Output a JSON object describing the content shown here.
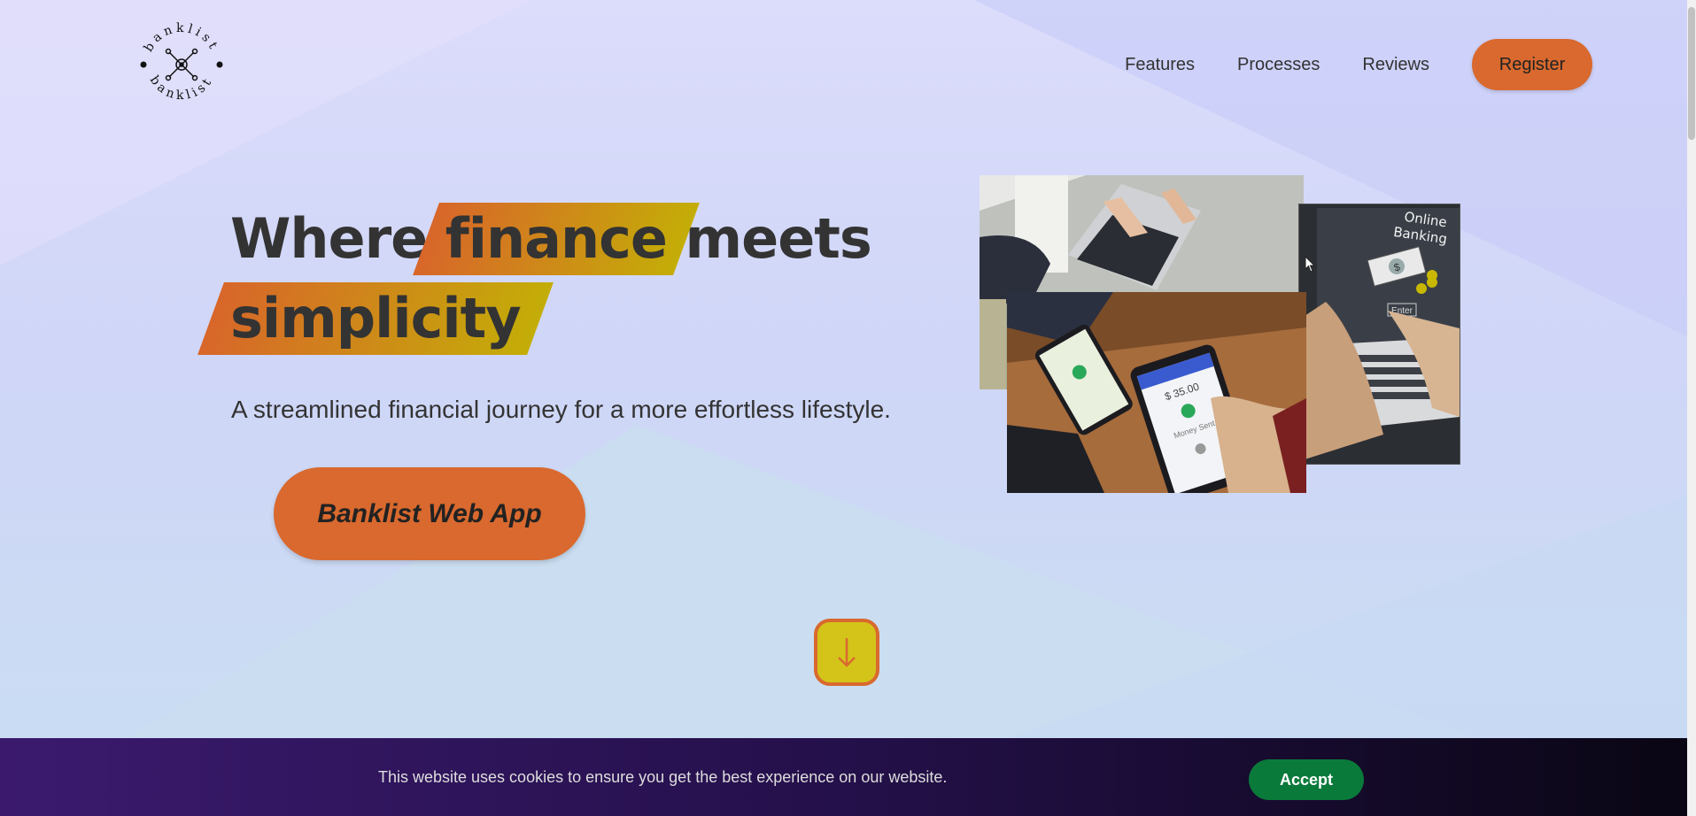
{
  "header": {
    "logo_text": "banklist",
    "nav": [
      {
        "label": "Features"
      },
      {
        "label": "Processes"
      },
      {
        "label": "Reviews"
      }
    ],
    "register_label": "Register"
  },
  "hero": {
    "title_word1": "Where",
    "title_highlight1": "finance",
    "title_word2": "meets",
    "title_highlight2": "simplicity",
    "subtitle": "A streamlined financial journey for a more effortless lifestyle.",
    "cta_label": "Banklist Web App",
    "scroll_icon": "arrow-down-icon"
  },
  "images": {
    "online_banking_title_line1": "Online",
    "online_banking_title_line2": "Banking",
    "online_banking_enter": "Enter",
    "phone_amount": "$ 35.00",
    "phone_label": "Money Sent"
  },
  "cookie": {
    "message": "This website uses cookies to ensure you get the best experience on our website.",
    "accept_label": "Accept"
  },
  "colors": {
    "accent": "#d9692e",
    "highlight_end": "#c4ad07",
    "accept_green": "#0a7a3b",
    "text": "#333333"
  }
}
